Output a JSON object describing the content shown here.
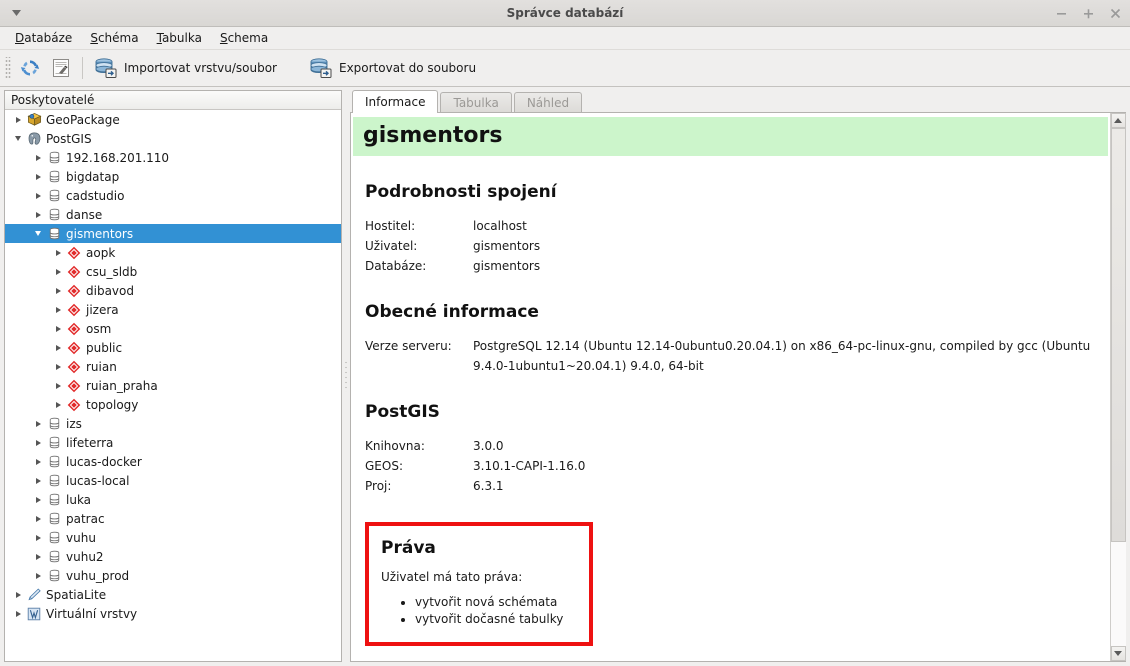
{
  "window": {
    "title": "Správce databází",
    "controls": {
      "minimize": "−",
      "maximize": "+",
      "close": "✕"
    },
    "menu_arrow": "▼"
  },
  "menubar": {
    "items": [
      {
        "mnemonic": "D",
        "rest": "atabáze"
      },
      {
        "mnemonic": "S",
        "rest": "chéma"
      },
      {
        "mnemonic": "T",
        "rest": "abulka"
      },
      {
        "mnemonic": "S",
        "rest": "chema"
      }
    ]
  },
  "toolbar": {
    "refresh_label": "",
    "sql_label": "",
    "import_label": "Importovat vrstvu/soubor",
    "export_label": "Exportovat do souboru"
  },
  "tree": {
    "header": "Poskytovatelé",
    "rows": [
      {
        "indent": 0,
        "twist": "closed",
        "icon": "geopackage-icon",
        "label": "GeoPackage",
        "selected": false
      },
      {
        "indent": 0,
        "twist": "open",
        "icon": "postgis-icon",
        "label": "PostGIS",
        "selected": false
      },
      {
        "indent": 1,
        "twist": "closed",
        "icon": "database-icon",
        "label": "192.168.201.110",
        "selected": false
      },
      {
        "indent": 1,
        "twist": "closed",
        "icon": "database-icon",
        "label": "bigdatap",
        "selected": false
      },
      {
        "indent": 1,
        "twist": "closed",
        "icon": "database-icon",
        "label": "cadstudio",
        "selected": false
      },
      {
        "indent": 1,
        "twist": "closed",
        "icon": "database-icon",
        "label": "danse",
        "selected": false
      },
      {
        "indent": 1,
        "twist": "open",
        "icon": "database-icon",
        "label": "gismentors",
        "selected": true
      },
      {
        "indent": 2,
        "twist": "closed",
        "icon": "schema-icon",
        "label": "aopk",
        "selected": false
      },
      {
        "indent": 2,
        "twist": "closed",
        "icon": "schema-icon",
        "label": "csu_sldb",
        "selected": false
      },
      {
        "indent": 2,
        "twist": "closed",
        "icon": "schema-icon",
        "label": "dibavod",
        "selected": false
      },
      {
        "indent": 2,
        "twist": "closed",
        "icon": "schema-icon",
        "label": "jizera",
        "selected": false
      },
      {
        "indent": 2,
        "twist": "closed",
        "icon": "schema-icon",
        "label": "osm",
        "selected": false
      },
      {
        "indent": 2,
        "twist": "closed",
        "icon": "schema-icon",
        "label": "public",
        "selected": false
      },
      {
        "indent": 2,
        "twist": "closed",
        "icon": "schema-icon",
        "label": "ruian",
        "selected": false
      },
      {
        "indent": 2,
        "twist": "closed",
        "icon": "schema-icon",
        "label": "ruian_praha",
        "selected": false
      },
      {
        "indent": 2,
        "twist": "closed",
        "icon": "schema-icon",
        "label": "topology",
        "selected": false
      },
      {
        "indent": 1,
        "twist": "closed",
        "icon": "database-icon",
        "label": "izs",
        "selected": false
      },
      {
        "indent": 1,
        "twist": "closed",
        "icon": "database-icon",
        "label": "lifeterra",
        "selected": false
      },
      {
        "indent": 1,
        "twist": "closed",
        "icon": "database-icon",
        "label": "lucas-docker",
        "selected": false
      },
      {
        "indent": 1,
        "twist": "closed",
        "icon": "database-icon",
        "label": "lucas-local",
        "selected": false
      },
      {
        "indent": 1,
        "twist": "closed",
        "icon": "database-icon",
        "label": "luka",
        "selected": false
      },
      {
        "indent": 1,
        "twist": "closed",
        "icon": "database-icon",
        "label": "patrac",
        "selected": false
      },
      {
        "indent": 1,
        "twist": "closed",
        "icon": "database-icon",
        "label": "vuhu",
        "selected": false
      },
      {
        "indent": 1,
        "twist": "closed",
        "icon": "database-icon",
        "label": "vuhu2",
        "selected": false
      },
      {
        "indent": 1,
        "twist": "closed",
        "icon": "database-icon",
        "label": "vuhu_prod",
        "selected": false
      },
      {
        "indent": 0,
        "twist": "closed",
        "icon": "spatialite-icon",
        "label": "SpatiaLite",
        "selected": false
      },
      {
        "indent": 0,
        "twist": "closed",
        "icon": "virtual-layers-icon",
        "label": "Virtuální vrstvy",
        "selected": false
      }
    ]
  },
  "tabs": [
    {
      "label": "Informace",
      "active": true
    },
    {
      "label": "Tabulka",
      "active": false
    },
    {
      "label": "Náhled",
      "active": false
    }
  ],
  "info": {
    "title": "gismentors",
    "connection": {
      "heading": "Podrobnosti spojení",
      "rows": [
        {
          "key": "Hostitel:",
          "value": "localhost"
        },
        {
          "key": "Uživatel:",
          "value": "gismentors"
        },
        {
          "key": "Databáze:",
          "value": "gismentors"
        }
      ]
    },
    "general": {
      "heading": "Obecné informace",
      "rows": [
        {
          "key": "Verze serveru:",
          "value": "PostgreSQL 12.14 (Ubuntu 12.14-0ubuntu0.20.04.1) on x86_64-pc-linux-gnu, compiled by gcc (Ubuntu 9.4.0-1ubuntu1~20.04.1) 9.4.0, 64-bit"
        }
      ]
    },
    "postgis": {
      "heading": "PostGIS",
      "rows": [
        {
          "key": "Knihovna:",
          "value": "3.0.0"
        },
        {
          "key": "GEOS:",
          "value": "3.10.1-CAPI-1.16.0"
        },
        {
          "key": "Proj:",
          "value": "6.3.1"
        }
      ]
    },
    "rights": {
      "heading": "Práva",
      "intro": "Uživatel má tato práva:",
      "items": [
        "vytvořit nová schémata",
        "vytvořit dočasné tabulky"
      ]
    }
  },
  "colors": {
    "selection": "#3291d4",
    "title_highlight": "#ccf5cb",
    "annotation_box": "#ee1111",
    "schema_icon": "#e03030"
  }
}
